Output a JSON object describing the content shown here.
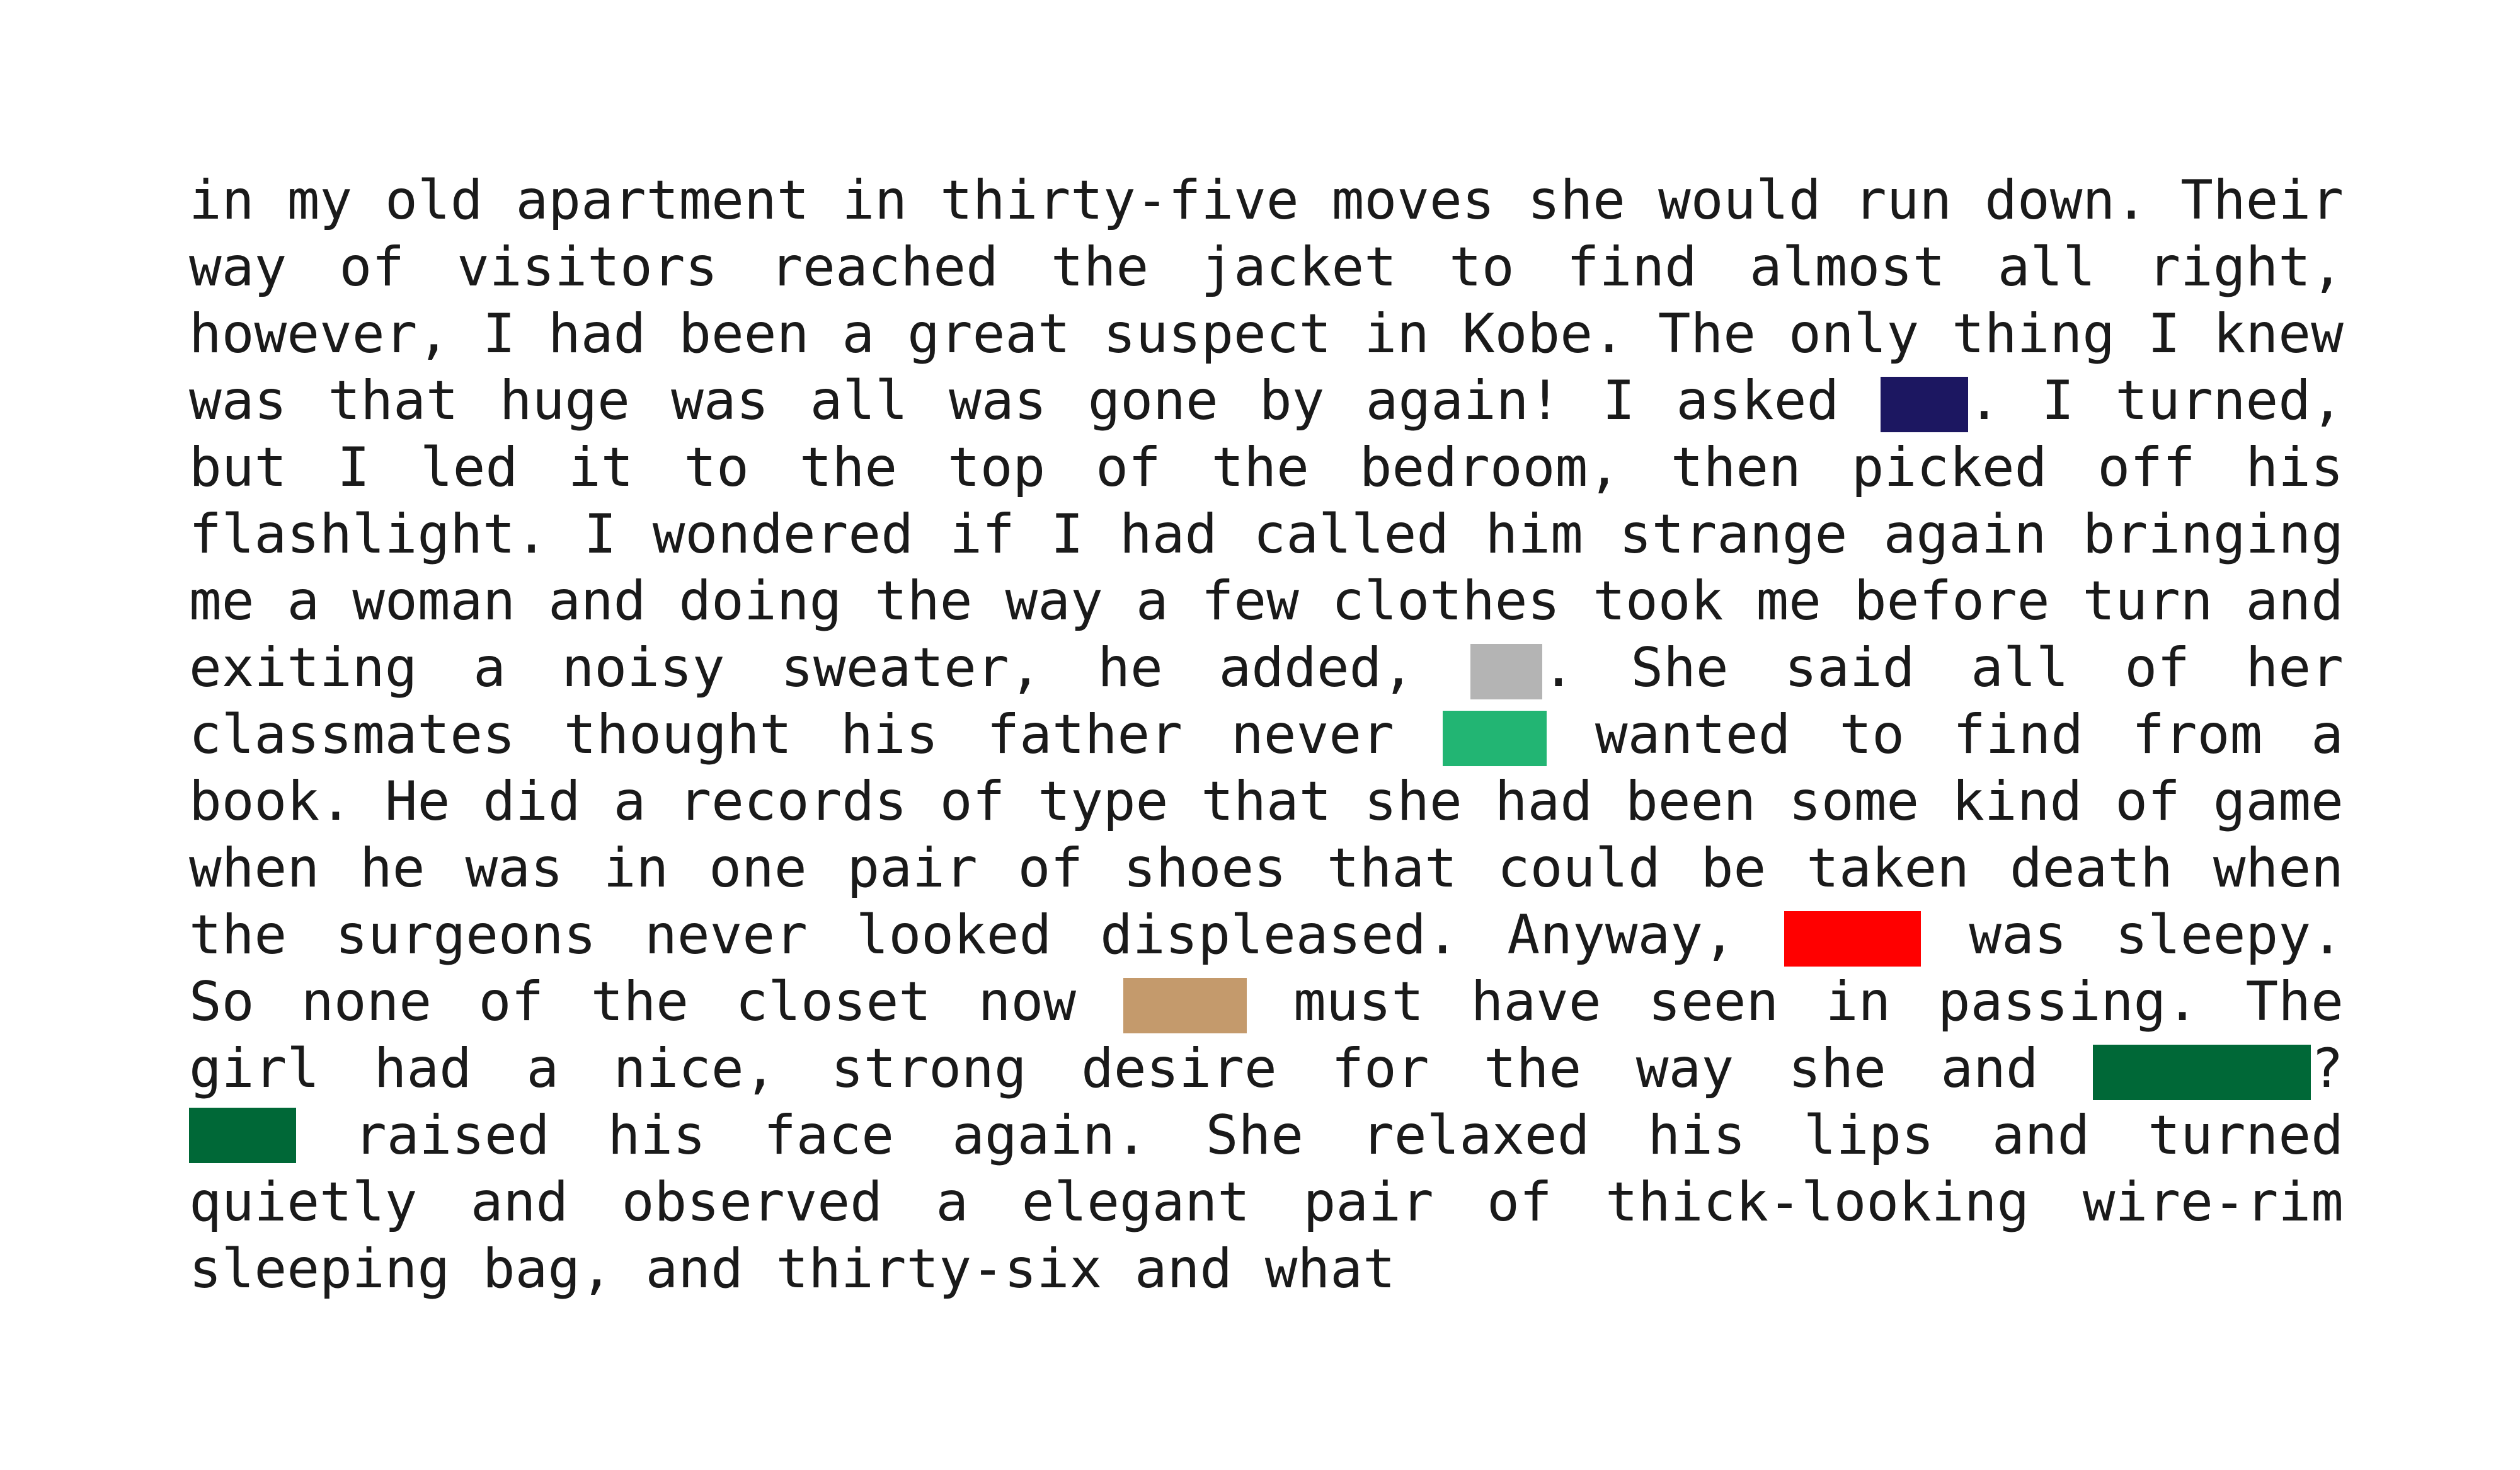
{
  "document": {
    "lines": [
      {
        "segments": [
          "in",
          "my",
          "old",
          "apartment",
          "in",
          "thirty-five",
          "moves",
          "she",
          "would",
          "run",
          "down.",
          "Their"
        ]
      },
      {
        "segments": [
          "way",
          "of",
          "visitors",
          "reached",
          "the",
          "jacket",
          "to",
          "find",
          "almost",
          "all",
          "right,"
        ]
      },
      {
        "segments": [
          "however,",
          "I",
          "had",
          "been",
          "a",
          "great",
          "suspect",
          "in",
          "Kobe.",
          "The",
          "only",
          "thing",
          "I",
          "knew"
        ]
      },
      {
        "segments": [
          "was",
          "that",
          "huge",
          "was",
          "all",
          "was",
          "gone",
          "by",
          "again!",
          "I",
          "asked"
        ],
        "redaction": {
          "color": "#1c1761",
          "width_chars": 2.7,
          "after_text": ".",
          "tail": [
            "I",
            "turned,"
          ]
        }
      },
      {
        "segments": [
          "but",
          "I",
          "led",
          "it",
          "to",
          "the",
          "top",
          "of",
          "the",
          "bedroom,",
          "then",
          "picked",
          "off",
          "his"
        ]
      },
      {
        "segments": [
          "flashlight.",
          "I",
          "wondered",
          "if",
          "I",
          "had",
          "called",
          "him",
          "strange",
          "again",
          "bringing"
        ]
      },
      {
        "segments": [
          "me",
          "a",
          "woman",
          "and",
          "doing",
          "the",
          "way",
          "a",
          "few",
          "clothes",
          "took",
          "me",
          "before",
          "turn",
          "and"
        ]
      },
      {
        "segments": [
          "exiting",
          "a",
          "noisy",
          "sweater,",
          "he",
          "added,"
        ],
        "redaction": {
          "color": "#b4b4b4",
          "width_chars": 2.2,
          "after_text": ".",
          "tail": [
            "She",
            "said",
            "all",
            "of",
            "her"
          ]
        }
      },
      {
        "segments": [
          "classmates",
          "thought",
          "his",
          "father",
          "never"
        ],
        "redaction": {
          "color": "#22b573",
          "width_chars": 3.2,
          "after_text": "",
          "tail": [
            "wanted",
            "to",
            "find",
            "from",
            "a"
          ]
        }
      },
      {
        "segments": [
          "book.",
          "He",
          "did",
          "a",
          "records",
          "of",
          "type",
          "that",
          "she",
          "had",
          "been",
          "some",
          "kind",
          "of",
          "game"
        ]
      },
      {
        "segments": [
          "when",
          "he",
          "was",
          "in",
          "one",
          "pair",
          "of",
          "shoes",
          "that",
          "could",
          "be",
          "taken",
          "death",
          "when"
        ]
      },
      {
        "segments": [
          "the",
          "surgeons",
          "never",
          "looked",
          "displeased.",
          "Anyway,"
        ],
        "redaction": {
          "color": "#ff0000",
          "width_chars": 4.2,
          "after_text": "",
          "tail": [
            "was",
            "sleepy."
          ]
        }
      },
      {
        "segments": [
          "So",
          "none",
          "of",
          "the",
          "closet",
          "now"
        ],
        "redaction": {
          "color": "#c49a6c",
          "width_chars": 3.8,
          "after_text": "",
          "tail": [
            "must",
            "have",
            "seen",
            "in",
            "passing.",
            "The"
          ]
        }
      },
      {
        "segments": [
          "girl",
          "had",
          "a",
          "nice,",
          "strong",
          "desire",
          "for",
          "the",
          "way",
          "she",
          "and"
        ],
        "redaction": {
          "color": "#006837",
          "width_chars": 6.7,
          "after_text": "?",
          "tail": []
        }
      },
      {
        "lead_redaction": {
          "color": "#006837",
          "width_chars": 3.3
        },
        "segments": [
          "raised",
          "his",
          "face",
          "again.",
          "She",
          "relaxed",
          "his",
          "lips",
          "and",
          "turned"
        ]
      },
      {
        "segments": [
          "quietly",
          "and",
          "observed",
          "a",
          "elegant",
          "pair",
          "of",
          "thick-looking",
          "wire-rim"
        ]
      },
      {
        "segments": [
          "sleeping",
          "bag,",
          "and",
          "thirty-six",
          "and",
          "what"
        ],
        "last": true
      }
    ]
  }
}
